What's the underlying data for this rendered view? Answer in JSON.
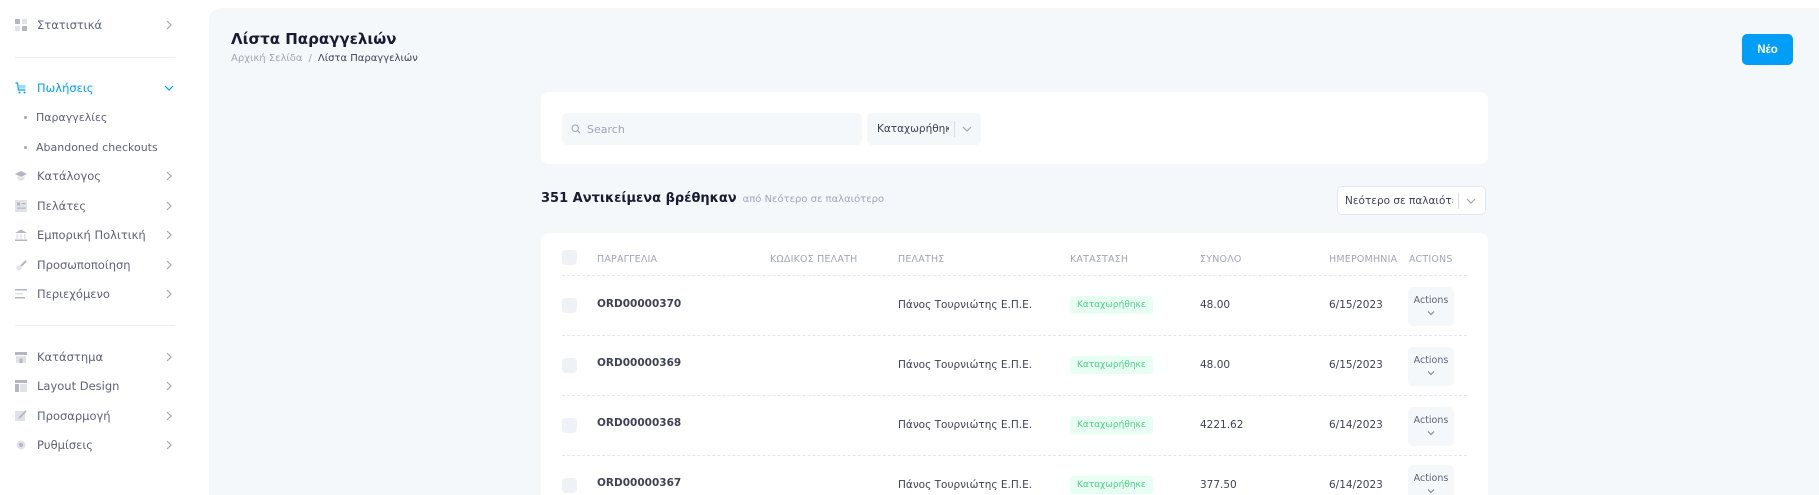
{
  "sidebar": {
    "items": [
      {
        "label": "Στατιστικά",
        "icon": "stats-icon"
      },
      {
        "label": "Πωλήσεις",
        "icon": "cart-icon",
        "active": true
      },
      {
        "label": "Κατάλογος",
        "icon": "catalog-icon"
      },
      {
        "label": "Πελάτες",
        "icon": "customers-icon"
      },
      {
        "label": "Εμπορική Πολιτική",
        "icon": "policy-icon"
      },
      {
        "label": "Προσωποποίηση",
        "icon": "personalization-icon"
      },
      {
        "label": "Περιεχόμενο",
        "icon": "content-icon"
      },
      {
        "label": "Κατάστημα",
        "icon": "store-icon"
      },
      {
        "label": "Layout Design",
        "icon": "layout-icon"
      },
      {
        "label": "Προσαρμογή",
        "icon": "customize-icon"
      },
      {
        "label": "Ρυθμίσεις",
        "icon": "settings-icon"
      }
    ],
    "sub_items": [
      {
        "label": "Παραγγελίες"
      },
      {
        "label": "Abandoned checkouts"
      }
    ]
  },
  "header": {
    "title": "Λίστα Παραγγελιών",
    "breadcrumb": [
      "Αρχική Σελίδα",
      "Λίστα Παραγγελιών"
    ],
    "breadcrumb_sep": "/",
    "new_button": "Νέο"
  },
  "filters": {
    "search_placeholder": "Search",
    "status_value": "Καταχωρήθηκε"
  },
  "results": {
    "count_text": "351 Αντικείμενα βρέθηκαν",
    "sort_text": "από Νεότερο σε παλαιότερο",
    "sort_select": "Νεότερο σε παλαιότερο"
  },
  "table": {
    "columns": [
      "ΠΑΡΑΓΓΕΛΙΑ",
      "ΚΩΔΙΚΟΣ ΠΕΛΑΤΗ",
      "ΠΕΛΑΤΗΣ",
      "ΚΑΤΑΣΤΑΣΗ",
      "ΣΥΝΟΛΟ",
      "ΗΜΕΡΟΜΗΝΙΑ",
      "ACTIONS"
    ],
    "rows": [
      {
        "order": "ORD00000370",
        "customer_code": "",
        "customer": "Πάνος Τουρνιώτης Ε.Π.Ε.",
        "status": "Καταχωρήθηκε",
        "total": "48.00",
        "date": "6/15/2023",
        "actions": "Actions"
      },
      {
        "order": "ORD00000369",
        "customer_code": "",
        "customer": "Πάνος Τουρνιώτης Ε.Π.Ε.",
        "status": "Καταχωρήθηκε",
        "total": "48.00",
        "date": "6/15/2023",
        "actions": "Actions"
      },
      {
        "order": "ORD00000368",
        "customer_code": "",
        "customer": "Πάνος Τουρνιώτης Ε.Π.Ε.",
        "status": "Καταχωρήθηκε",
        "total": "4221.62",
        "date": "6/14/2023",
        "actions": "Actions"
      },
      {
        "order": "ORD00000367",
        "customer_code": "",
        "customer": "Πάνος Τουρνιώτης Ε.Π.Ε.",
        "status": "Καταχωρήθηκε",
        "total": "377.50",
        "date": "6/14/2023",
        "actions": "Actions"
      }
    ]
  },
  "colors": {
    "accent": "#009ef7",
    "success_text": "#50cd89",
    "success_bg": "#e8fff3",
    "muted": "#a1a5b7"
  }
}
